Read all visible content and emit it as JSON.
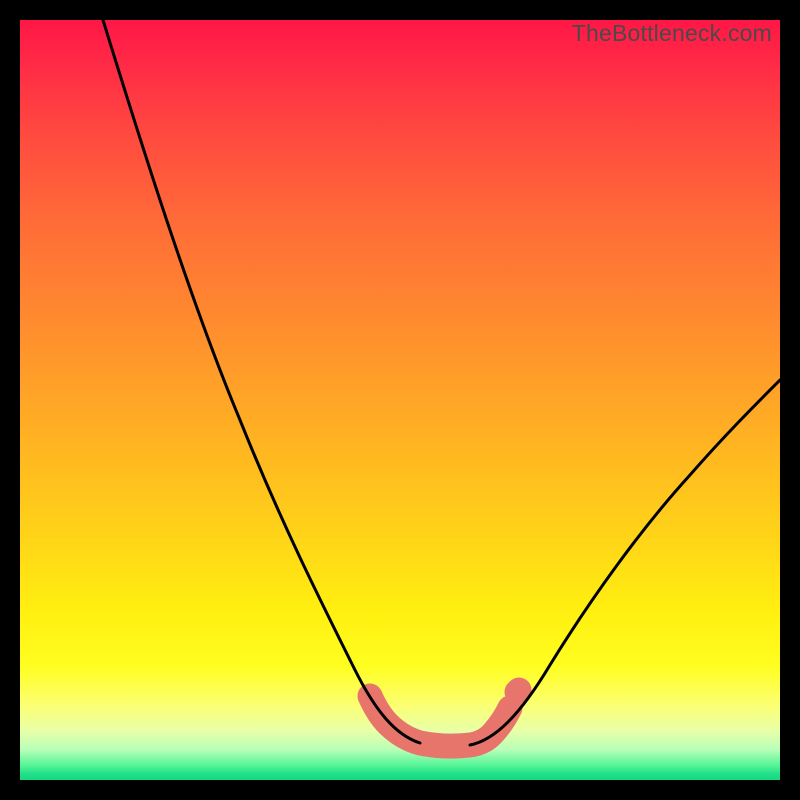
{
  "watermark": "TheBottleneck.com",
  "chart_data": {
    "type": "line",
    "title": "",
    "xlabel": "",
    "ylabel": "",
    "xlim": [
      0,
      100
    ],
    "ylim": [
      0,
      100
    ],
    "grid": false,
    "legend": false,
    "background": {
      "gradient_stops": [
        {
          "pos": 0,
          "color": "#ff1746"
        },
        {
          "pos": 14,
          "color": "#ff4640"
        },
        {
          "pos": 40,
          "color": "#ff8c2e"
        },
        {
          "pos": 68,
          "color": "#ffd418"
        },
        {
          "pos": 85,
          "color": "#fffe20"
        },
        {
          "pos": 96,
          "color": "#b8ffb8"
        },
        {
          "pos": 100,
          "color": "#18d882"
        }
      ]
    },
    "series": [
      {
        "name": "left-curve",
        "stroke": "#000000",
        "x": [
          11,
          15,
          19,
          23,
          27,
          31,
          34,
          37,
          40,
          43,
          46,
          48,
          50
        ],
        "y": [
          100,
          88,
          77,
          66,
          56,
          46,
          37,
          29,
          22,
          16,
          11,
          8,
          6
        ]
      },
      {
        "name": "right-curve",
        "stroke": "#000000",
        "x": [
          62,
          65,
          68,
          72,
          76,
          80,
          85,
          90,
          95,
          100
        ],
        "y": [
          6,
          8,
          11,
          16,
          22,
          28,
          35,
          42,
          49,
          55
        ]
      },
      {
        "name": "valley-highlight",
        "stroke": "#e8756c",
        "x": [
          46,
          48,
          50,
          53,
          56,
          59,
          62,
          64
        ],
        "y": [
          11,
          8,
          6,
          5,
          5,
          5,
          6,
          8
        ]
      }
    ]
  }
}
